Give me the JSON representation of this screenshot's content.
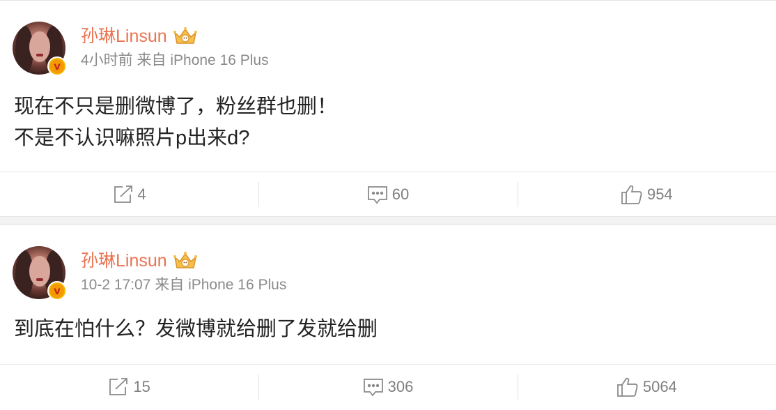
{
  "colors": {
    "username": "#eb7350",
    "meta": "#8a8a8a",
    "body_text": "#222222",
    "action": "#808080",
    "badge": "#f5b400",
    "background": "#f2f2f2"
  },
  "posts": [
    {
      "username": "孙琳Linsun",
      "verified_badge_icon": "v-badge-icon",
      "member_icon": "crown-icon",
      "meta": "4小时前 来自 iPhone 16 Plus",
      "lines": [
        "现在不只是删微博了，粉丝群也删！",
        "不是不认识嘛照片p出来d?"
      ],
      "actions": {
        "repost": "4",
        "comment": "60",
        "like": "954"
      }
    },
    {
      "username": "孙琳Linsun",
      "verified_badge_icon": "v-badge-icon",
      "member_icon": "crown-icon",
      "meta": "10-2 17:07 来自 iPhone 16 Plus",
      "lines": [
        "到底在怕什么？发微博就给删了发就给删"
      ],
      "actions": {
        "repost": "15",
        "comment": "306",
        "like": "5064"
      }
    }
  ]
}
